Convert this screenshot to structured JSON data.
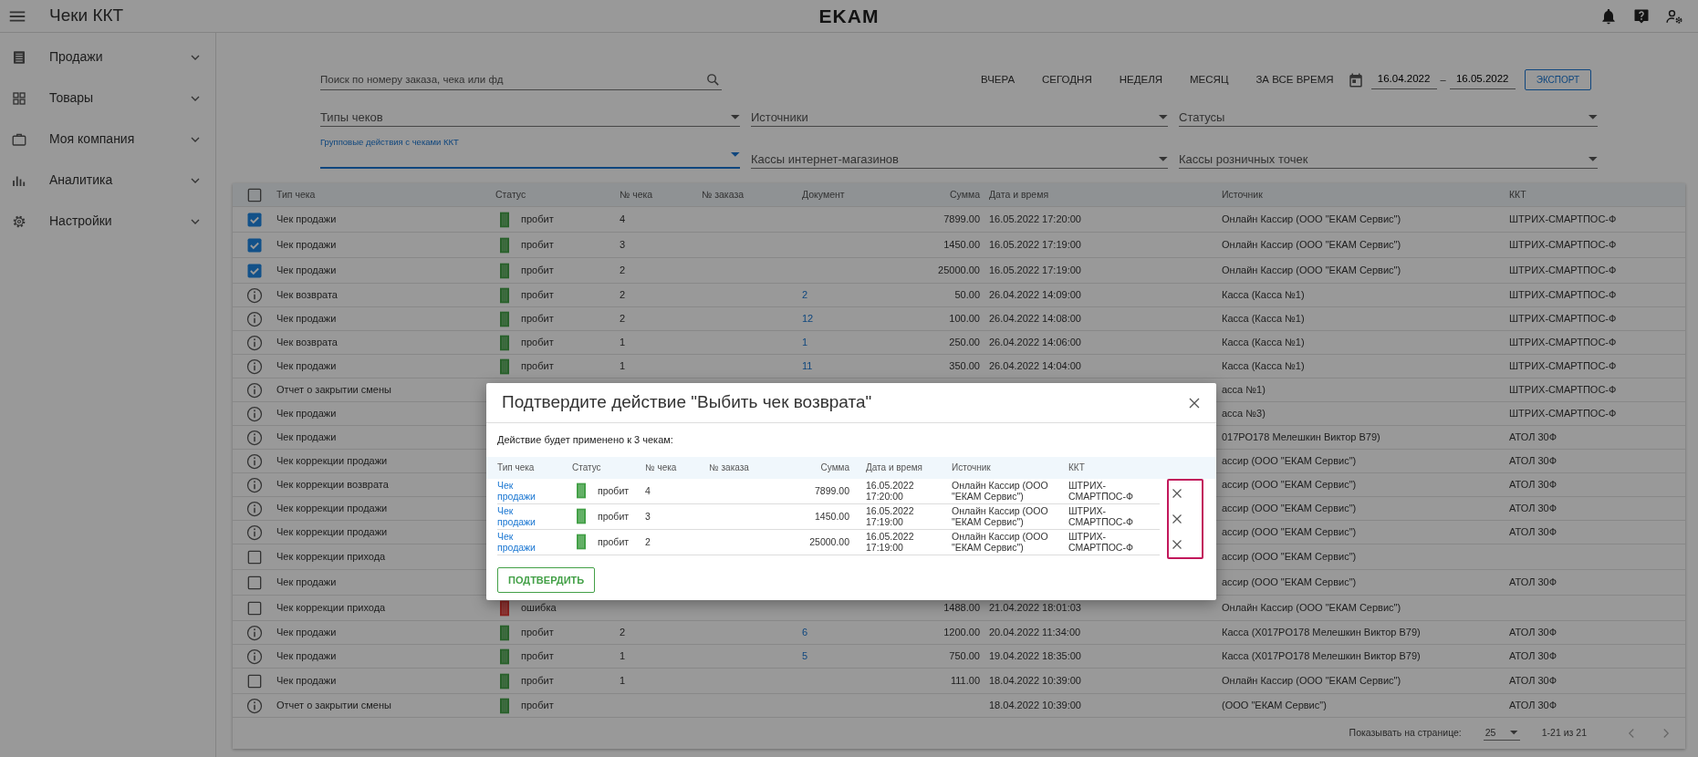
{
  "header": {
    "title": "Чеки ККТ",
    "logo": "EKAM"
  },
  "sidebar": {
    "items": [
      {
        "label": "Продажи"
      },
      {
        "label": "Товары"
      },
      {
        "label": "Моя компания"
      },
      {
        "label": "Аналитика"
      },
      {
        "label": "Настройки"
      }
    ]
  },
  "filters": {
    "search": {
      "placeholder": "Поиск по номеру заказа, чека или фд"
    },
    "periods": [
      "ВЧЕРА",
      "СЕГОДНЯ",
      "НЕДЕЛЯ",
      "МЕСЯЦ",
      "ЗА ВСЕ ВРЕМЯ"
    ],
    "date_from": "16.04.2022",
    "date_separator": "–",
    "date_to": "16.05.2022",
    "export_button": "ЭКСПОРТ",
    "selects": [
      {
        "placeholder": "Типы чеков"
      },
      {
        "placeholder": "Источники"
      },
      {
        "placeholder": "Статусы"
      },
      {
        "label": "Групповые действия с чеками ККТ",
        "focused": true
      },
      {
        "placeholder": "Кассы интернет-магазинов"
      },
      {
        "placeholder": "Кассы розничных точек"
      }
    ]
  },
  "table": {
    "select_all": {
      "checked": false
    },
    "columns": [
      "Тип чека",
      "Статус",
      "№ чека",
      "№ заказа",
      "Документ",
      "Сумма",
      "Дата и время",
      "Источник",
      "ККТ"
    ],
    "rows": [
      {
        "kind": "checkbox",
        "checked": true,
        "type": "Чек продажи",
        "status": {
          "label": "пробит",
          "kind": "ok"
        },
        "number": "4",
        "sum": "7899.00",
        "date": "16.05.2022 17:20:00",
        "source": "Онлайн Кассир (ООО \"ЕКАМ Сервис\")",
        "kkt": "ШТРИХ-СМАРТПОС-Ф"
      },
      {
        "kind": "checkbox",
        "checked": true,
        "type": "Чек продажи",
        "status": {
          "label": "пробит",
          "kind": "ok"
        },
        "number": "3",
        "sum": "1450.00",
        "date": "16.05.2022 17:19:00",
        "source": "Онлайн Кассир (ООО \"ЕКАМ Сервис\")",
        "kkt": "ШТРИХ-СМАРТПОС-Ф"
      },
      {
        "kind": "checkbox",
        "checked": true,
        "type": "Чек продажи",
        "status": {
          "label": "пробит",
          "kind": "ok"
        },
        "number": "2",
        "sum": "25000.00",
        "date": "16.05.2022 17:19:00",
        "source": "Онлайн Кассир (ООО \"ЕКАМ Сервис\")",
        "kkt": "ШТРИХ-СМАРТПОС-Ф"
      },
      {
        "kind": "info",
        "type": "Чек возврата",
        "status": {
          "label": "пробит",
          "kind": "ok"
        },
        "number": "2",
        "document": "2",
        "sum": "50.00",
        "date": "26.04.2022 14:09:00",
        "source": "Касса (Касса №1)",
        "kkt": "ШТРИХ-СМАРТПОС-Ф"
      },
      {
        "kind": "info",
        "type": "Чек продажи",
        "status": {
          "label": "пробит",
          "kind": "ok"
        },
        "number": "2",
        "document": "12",
        "sum": "100.00",
        "date": "26.04.2022 14:08:00",
        "source": "Касса (Касса №1)",
        "kkt": "ШТРИХ-СМАРТПОС-Ф"
      },
      {
        "kind": "info",
        "type": "Чек возврата",
        "status": {
          "label": "пробит",
          "kind": "ok"
        },
        "number": "1",
        "document": "1",
        "sum": "250.00",
        "date": "26.04.2022 14:06:00",
        "source": "Касса (Касса №1)",
        "kkt": "ШТРИХ-СМАРТПОС-Ф"
      },
      {
        "kind": "info",
        "type": "Чек продажи",
        "status": {
          "label": "пробит",
          "kind": "ok"
        },
        "number": "1",
        "document": "11",
        "sum": "350.00",
        "date": "26.04.2022 14:04:00",
        "source": "Касса (Касса №1)",
        "kkt": "ШТРИХ-СМАРТПОС-Ф"
      },
      {
        "kind": "info",
        "type": "Отчет о закрытии смены",
        "source": "асса №1)",
        "kkt": "ШТРИХ-СМАРТПОС-Ф"
      },
      {
        "kind": "info",
        "type": "Чек продажи",
        "source": "асса №3)",
        "kkt": "ШТРИХ-СМАРТПОС-Ф"
      },
      {
        "kind": "info",
        "type": "Чек продажи",
        "source": "017РО178 Мелешкин Виктор В79)",
        "kkt": "АТОЛ 30Ф"
      },
      {
        "kind": "info",
        "type": "Чек коррекции продажи",
        "source": "ассир (ООО \"ЕКАМ Сервис\")",
        "kkt": "АТОЛ 30Ф"
      },
      {
        "kind": "info",
        "type": "Чек коррекции возврата",
        "source": "ассир (ООО \"ЕКАМ Сервис\")",
        "kkt": "АТОЛ 30Ф"
      },
      {
        "kind": "info",
        "type": "Чек коррекции продажи",
        "source": "ассир (ООО \"ЕКАМ Сервис\")",
        "kkt": "АТОЛ 30Ф"
      },
      {
        "kind": "info",
        "type": "Чек коррекции продажи",
        "source": "ассир (ООО \"ЕКАМ Сервис\")",
        "kkt": "АТОЛ 30Ф"
      },
      {
        "kind": "checkbox",
        "checked": false,
        "type": "Чек коррекции прихода",
        "source": "ассир (ООО \"ЕКАМ Сервис\")"
      },
      {
        "kind": "checkbox",
        "checked": false,
        "type": "Чек продажи",
        "source": "ассир (ООО \"ЕКАМ Сервис\")",
        "kkt": "АТОЛ 30Ф"
      },
      {
        "kind": "checkbox",
        "checked": false,
        "type": "Чек коррекции прихода",
        "status": {
          "label": "ошибка",
          "kind": "error"
        },
        "sum": "1488.00",
        "date": "21.04.2022 18:01:03",
        "source": "Онлайн Кассир (ООО \"ЕКАМ Сервис\")"
      },
      {
        "kind": "info",
        "type": "Чек продажи",
        "status": {
          "label": "пробит",
          "kind": "ok"
        },
        "number": "2",
        "document": "6",
        "sum": "1200.00",
        "date": "20.04.2022 11:34:00",
        "source": "Касса (X017PO178 Мелешкин Виктор В79)",
        "kkt": "АТОЛ 30Ф"
      },
      {
        "kind": "info",
        "type": "Чек продажи",
        "status": {
          "label": "пробит",
          "kind": "ok"
        },
        "number": "1",
        "document": "5",
        "sum": "750.00",
        "date": "19.04.2022 18:35:00",
        "source": "Касса (X017PO178 Мелешкин Виктор В79)",
        "kkt": "АТОЛ 30Ф"
      },
      {
        "kind": "checkbox",
        "checked": false,
        "type": "Чек продажи",
        "status": {
          "label": "пробит",
          "kind": "ok"
        },
        "number": "1",
        "sum": "111.00",
        "date": "18.04.2022 10:39:00",
        "source": "Онлайн Кассир (ООО \"ЕКАМ Сервис\")",
        "kkt": "АТОЛ 30Ф"
      },
      {
        "kind": "info",
        "type": "Отчет о закрытии смены",
        "status": {
          "label": "пробит",
          "kind": "ok"
        },
        "date": "18.04.2022 10:39:00",
        "source": "(ООО \"ЕКАМ Сервис\")",
        "kkt": "АТОЛ 30Ф"
      }
    ]
  },
  "pagination": {
    "label": "Показывать на странице:",
    "page_size": "25",
    "range": "1-21 из 21"
  },
  "modal": {
    "title": "Подтвердите действие \"Выбить чек возврата\"",
    "message": "Действие будет применено к 3 чекам:",
    "columns": [
      "Тип чека",
      "Статус",
      "№ чека",
      "№ заказа",
      "Сумма",
      "Дата и время",
      "Источник",
      "ККТ"
    ],
    "rows": [
      {
        "type": "Чек продажи",
        "status": {
          "label": "пробит",
          "kind": "ok"
        },
        "number": "4",
        "sum": "7899.00",
        "date": "16.05.2022 17:20:00",
        "source": "Онлайн Кассир (ООО \"ЕКАМ Сервис\")",
        "kkt": "ШТРИХ-СМАРТПОС-Ф"
      },
      {
        "type": "Чек продажи",
        "status": {
          "label": "пробит",
          "kind": "ok"
        },
        "number": "3",
        "sum": "1450.00",
        "date": "16.05.2022 17:19:00",
        "source": "Онлайн Кассир (ООО \"ЕКАМ Сервис\")",
        "kkt": "ШТРИХ-СМАРТПОС-Ф"
      },
      {
        "type": "Чек продажи",
        "status": {
          "label": "пробит",
          "kind": "ok"
        },
        "number": "2",
        "sum": "25000.00",
        "date": "16.05.2022 17:19:00",
        "source": "Онлайн Кассир (ООО \"ЕКАМ Сервис\")",
        "kkt": "ШТРИХ-СМАРТПОС-Ф"
      }
    ],
    "confirm_button": "ПОДТВЕРДИТЬ"
  }
}
